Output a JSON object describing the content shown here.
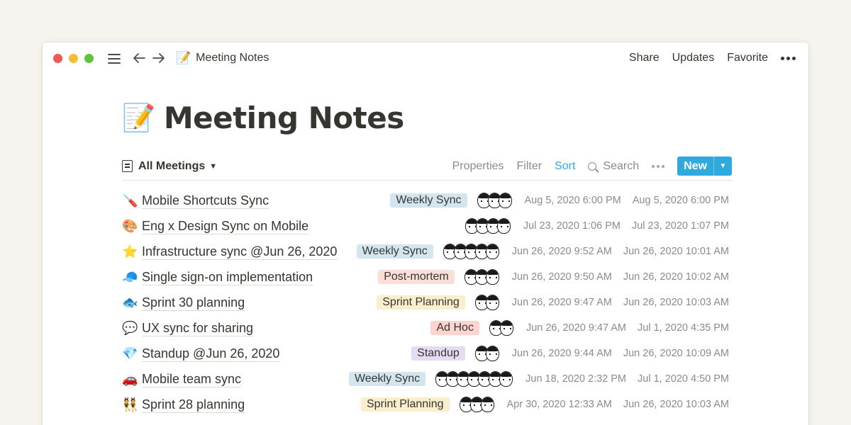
{
  "window": {
    "breadcrumb_title": "Meeting Notes",
    "breadcrumb_emoji": "📝"
  },
  "topbar": {
    "share": "Share",
    "updates": "Updates",
    "favorite": "Favorite"
  },
  "page": {
    "emoji": "📝",
    "title": "Meeting Notes"
  },
  "view": {
    "name": "All Meetings",
    "properties": "Properties",
    "filter": "Filter",
    "sort": "Sort",
    "search": "Search",
    "new_label": "New"
  },
  "colors": {
    "accent": "#2eaadc",
    "tag_weekly_sync": "#d3e5ef",
    "tag_post_mortem": "#fadfd8",
    "tag_sprint_planning": "#fbeecc",
    "tag_ad_hoc": "#ffd4d0",
    "tag_standup": "#e6dbf5"
  },
  "rows": [
    {
      "emoji": "🪛",
      "name": "Mobile Shortcuts Sync",
      "tag": "Weekly Sync",
      "tag_color": "#d3e5ef",
      "avatars": 3,
      "created": "Aug 5, 2020 6:00 PM",
      "updated": "Aug 5, 2020 6:00 PM"
    },
    {
      "emoji": "🎨",
      "name": "Eng x Design Sync on Mobile",
      "tag": "",
      "tag_color": "",
      "avatars": 4,
      "created": "Jul 23, 2020 1:06 PM",
      "updated": "Jul 23, 2020 1:07 PM"
    },
    {
      "emoji": "⭐",
      "name": "Infrastructure sync @Jun 26, 2020",
      "tag": "Weekly Sync",
      "tag_color": "#d3e5ef",
      "avatars": 5,
      "created": "Jun 26, 2020 9:52 AM",
      "updated": "Jun 26, 2020 10:01 AM"
    },
    {
      "emoji": "🧢",
      "name": "Single sign-on implementation",
      "tag": "Post-mortem",
      "tag_color": "#fadfd8",
      "avatars": 3,
      "created": "Jun 26, 2020 9:50 AM",
      "updated": "Jun 26, 2020 10:02 AM"
    },
    {
      "emoji": "🐟",
      "name": "Sprint 30 planning",
      "tag": "Sprint Planning",
      "tag_color": "#fbeecc",
      "avatars": 2,
      "created": "Jun 26, 2020 9:47 AM",
      "updated": "Jun 26, 2020 10:03 AM"
    },
    {
      "emoji": "💬",
      "name": "UX sync for sharing",
      "tag": "Ad Hoc",
      "tag_color": "#ffd4d0",
      "avatars": 2,
      "created": "Jun 26, 2020 9:47 AM",
      "updated": "Jul 1, 2020 4:35 PM"
    },
    {
      "emoji": "💎",
      "name": "Standup @Jun 26, 2020",
      "tag": "Standup",
      "tag_color": "#e6dbf5",
      "avatars": 2,
      "created": "Jun 26, 2020 9:44 AM",
      "updated": "Jun 26, 2020 10:09 AM"
    },
    {
      "emoji": "🚗",
      "name": "Mobile team sync",
      "tag": "Weekly Sync",
      "tag_color": "#d3e5ef",
      "avatars": 7,
      "created": "Jun 18, 2020 2:32 PM",
      "updated": "Jul 1, 2020 4:50 PM"
    },
    {
      "emoji": "👯",
      "name": "Sprint 28 planning",
      "tag": "Sprint Planning",
      "tag_color": "#fbeecc",
      "avatars": 3,
      "created": "Apr 30, 2020 12:33 AM",
      "updated": "Jun 26, 2020 10:03 AM"
    }
  ]
}
